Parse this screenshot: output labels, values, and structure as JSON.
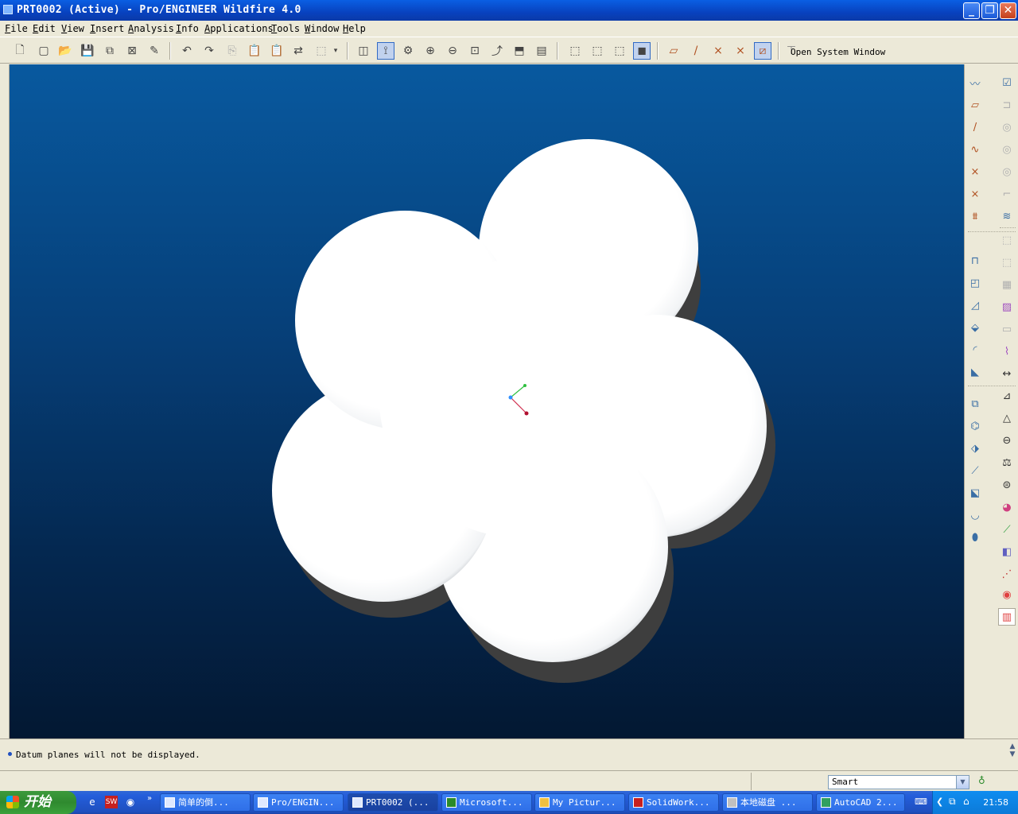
{
  "window": {
    "title": "PRT0002 (Active) - Pro/ENGINEER Wildfire 4.0",
    "controls": {
      "minimize": "_",
      "maximize": "❐",
      "close": "✕"
    }
  },
  "menu": [
    {
      "label": "File"
    },
    {
      "label": "Edit"
    },
    {
      "label": "View"
    },
    {
      "label": "Insert"
    },
    {
      "label": "Analysis"
    },
    {
      "label": "Info"
    },
    {
      "label": "Applications"
    },
    {
      "label": "Tools"
    },
    {
      "label": "Window"
    },
    {
      "label": "Help"
    }
  ],
  "toolbar": {
    "open_system_window": "Open System Window",
    "icons": [
      "new-icon",
      "open-icon",
      "save-icon",
      "save-copy-icon",
      "close-window-icon",
      "regenerate-icon",
      "undo-icon",
      "redo-icon",
      "copy-icon",
      "paste-icon",
      "paste-special-icon",
      "regen-manager-icon",
      "select-box-icon",
      "datum-display-icon",
      "spin-center-icon",
      "orient-icon",
      "zoom-in-icon",
      "zoom-out-icon",
      "refit-icon",
      "reorient-icon",
      "saved-views-icon",
      "layers-icon",
      "wireframe-icon",
      "hidden-line-icon",
      "no-hidden-icon",
      "shading-icon",
      "datum-planes-icon",
      "datum-axes-icon",
      "datum-points-icon",
      "coord-sys-icon",
      "annotations-icon"
    ]
  },
  "viewport": {
    "background_top": "#08599f",
    "background_bottom": "#031832",
    "model": "flower-shaped extrusion",
    "csys_colors": {
      "x": "#d03030",
      "y": "#30c040",
      "z": "#3070ff"
    }
  },
  "message_area": {
    "message": "Datum planes will not be displayed."
  },
  "status": {
    "filter_value": "Smart"
  },
  "taskbar": {
    "start_label": "开始",
    "tasks": [
      {
        "label": "简单的倒..."
      },
      {
        "label": "Pro/ENGIN..."
      },
      {
        "label": "PRT0002 (..."
      },
      {
        "label": "Microsoft..."
      },
      {
        "label": "My Pictur..."
      },
      {
        "label": "SolidWork..."
      },
      {
        "label": "本地磁盘 ..."
      },
      {
        "label": "AutoCAD 2..."
      }
    ],
    "clock": "21:58"
  }
}
